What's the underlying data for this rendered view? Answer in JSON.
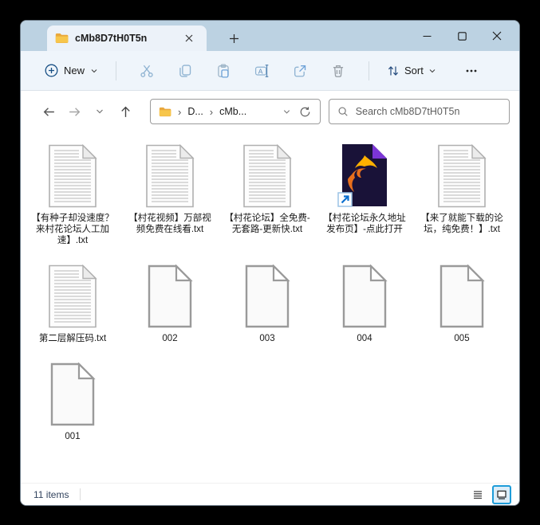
{
  "window": {
    "tab_title": "cMb8D7tH0T5n"
  },
  "toolbar": {
    "new_label": "New",
    "sort_label": "Sort"
  },
  "navbar": {
    "breadcrumb_items": [
      "D...",
      "cMb..."
    ],
    "breadcrumb_separator": "›",
    "search_placeholder": "Search cMb8D7tH0T5n"
  },
  "files": [
    {
      "name": "【有种子却没速度？来村花论坛人工加速】.txt",
      "type": "txt"
    },
    {
      "name": "【村花视频】万部视频免费在线看.txt",
      "type": "txt"
    },
    {
      "name": "【村花论坛】全免费-无套路-更新快.txt",
      "type": "txt"
    },
    {
      "name": "【村花论坛永久地址发布页】-点此打开",
      "type": "firefox-shortcut"
    },
    {
      "name": "【来了就能下载的论坛，纯免费！】.txt",
      "type": "txt"
    },
    {
      "name": "第二层解压码.txt",
      "type": "txt"
    },
    {
      "name": "002",
      "type": "file"
    },
    {
      "name": "003",
      "type": "file"
    },
    {
      "name": "004",
      "type": "file"
    },
    {
      "name": "005",
      "type": "file"
    },
    {
      "name": "001",
      "type": "file"
    }
  ],
  "statusbar": {
    "items_text": "11 items"
  },
  "icons": {
    "new": "⊕",
    "cut": "✂",
    "copy": "⧉",
    "paste": "📋",
    "rename": "A]",
    "share": "↗",
    "delete": "🗑",
    "sort": "↑↓",
    "more": "…",
    "back": "←",
    "forward": "→",
    "up": "↑",
    "recent": "⌄",
    "refresh": "⟳",
    "search": "🔍",
    "folder": "📁",
    "minimize": "–",
    "maximize": "□",
    "close": "✕",
    "new-tab": "+",
    "shortcut-overlay": "↗"
  },
  "colors": {
    "titlebar": "#bcd2e2",
    "active_tab": "#ecf2f9",
    "toolbar_bg": "#eff5fb",
    "accent_view_selected": "#1d9cd9",
    "status_text": "#32435e",
    "folder_yellow": "#f7c64b",
    "firefox_doc_bg": "#191238",
    "firefox_fold": "#7b35d6"
  }
}
